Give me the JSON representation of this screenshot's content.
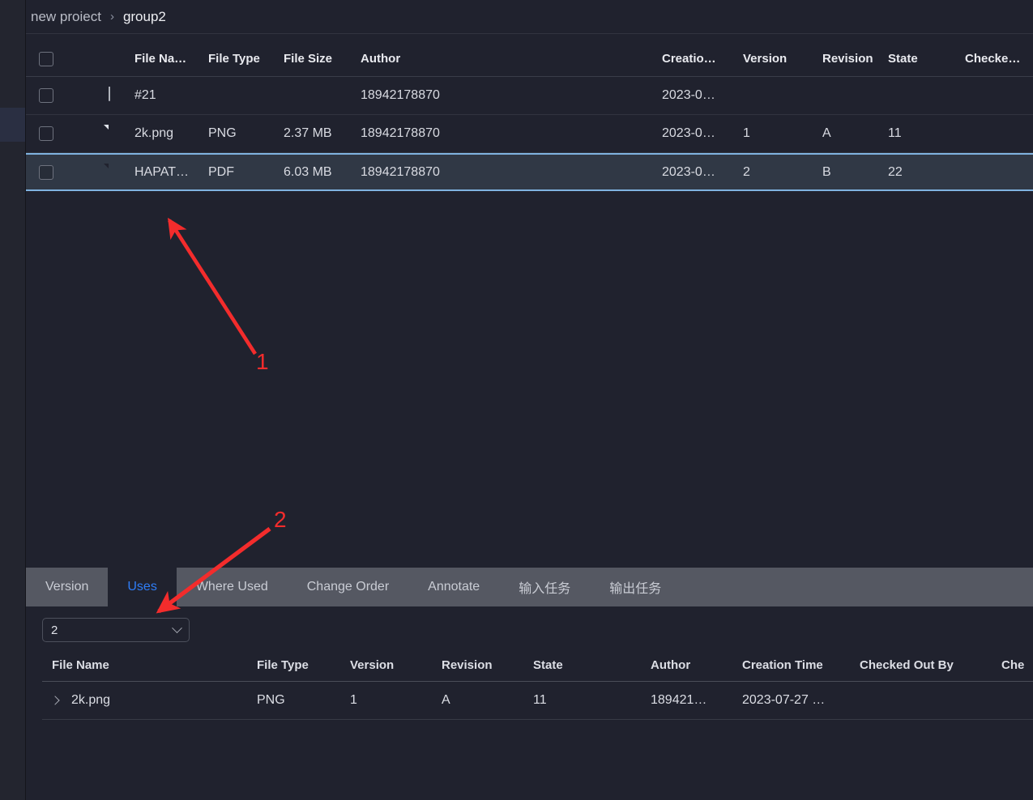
{
  "breadcrumb": {
    "root": "new proiect",
    "separator": "›",
    "leaf": "group2"
  },
  "top_table": {
    "columns": [
      {
        "key": "check",
        "label": ""
      },
      {
        "key": "icon",
        "label": ""
      },
      {
        "key": "name",
        "label": "File Na…"
      },
      {
        "key": "type",
        "label": "File Type"
      },
      {
        "key": "size",
        "label": "File Size"
      },
      {
        "key": "author",
        "label": "Author"
      },
      {
        "key": "creation",
        "label": "Creatio…"
      },
      {
        "key": "version",
        "label": "Version"
      },
      {
        "key": "revision",
        "label": "Revision"
      },
      {
        "key": "state",
        "label": "State"
      },
      {
        "key": "checked_out",
        "label": "Checke…"
      }
    ],
    "rows": [
      {
        "icon": "folder-icon",
        "name": "#21",
        "type": "",
        "size": "",
        "author": "18942178870",
        "creation": "2023-0…",
        "version": "",
        "revision": "",
        "state": "",
        "checked_out": "",
        "selected": false
      },
      {
        "icon": "image-file-icon",
        "name": "2k.png",
        "type": "PNG",
        "size": "2.37 MB",
        "author": "18942178870",
        "creation": "2023-0…",
        "version": "1",
        "revision": "A",
        "state": "11",
        "checked_out": "",
        "selected": false
      },
      {
        "icon": "pdf-file-icon",
        "name": "HAPAT…",
        "type": "PDF",
        "size": "6.03 MB",
        "author": "18942178870",
        "creation": "2023-0…",
        "version": "2",
        "revision": "B",
        "state": "22",
        "checked_out": "",
        "selected": true
      }
    ]
  },
  "bottom_panel": {
    "tabs": [
      {
        "label": "Version",
        "active": false
      },
      {
        "label": "Uses",
        "active": true
      },
      {
        "label": "Where Used",
        "active": false
      },
      {
        "label": "Change Order",
        "active": false
      },
      {
        "label": "Annotate",
        "active": false
      },
      {
        "label": "输入任务",
        "active": false
      },
      {
        "label": "输出任务",
        "active": false
      }
    ],
    "version_select": {
      "value": "2",
      "icon": "chevron-down-icon"
    },
    "columns": [
      {
        "key": "name",
        "label": "File Name"
      },
      {
        "key": "type",
        "label": "File Type"
      },
      {
        "key": "version",
        "label": "Version"
      },
      {
        "key": "revision",
        "label": "Revision"
      },
      {
        "key": "state",
        "label": "State"
      },
      {
        "key": "author",
        "label": "Author"
      },
      {
        "key": "creation",
        "label": "Creation Time"
      },
      {
        "key": "checked_out_by",
        "label": "Checked Out By"
      },
      {
        "key": "che",
        "label": "Che"
      }
    ],
    "rows": [
      {
        "expand_icon": "chevron-right-icon",
        "name": "2k.png",
        "type": "PNG",
        "version": "1",
        "revision": "A",
        "state": "11",
        "author": "189421…",
        "creation": "2023-07-27 …",
        "checked_out_by": "",
        "che": ""
      }
    ]
  },
  "annotations": [
    {
      "label": "1",
      "color": "#f32c2c"
    },
    {
      "label": "2",
      "color": "#f32c2c"
    }
  ],
  "colors": {
    "background": "#20222e",
    "selected_row": "#303845",
    "selected_border": "#7fb2e0",
    "active_tab_text": "#2f7df6",
    "tabbar": "#555862",
    "annotation": "#f32c2c"
  }
}
